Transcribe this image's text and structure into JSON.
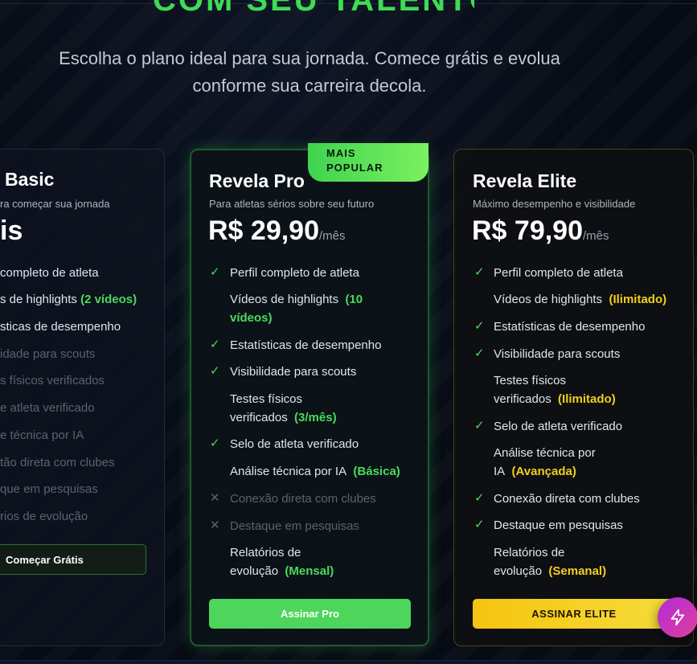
{
  "hero": {
    "heading_fragment": "COM SEU TALENTO",
    "subtitle_line1": "Escolha o plano ideal para sua jornada. Comece grátis e evolua",
    "subtitle_line2": "conforme sua carreira decola."
  },
  "plans": {
    "basic": {
      "name": "Basic",
      "name_visible": "Basic",
      "desc": "ra começar sua jornada",
      "price": "is",
      "features": [
        "completo de atleta",
        "s de highlights",
        "(2 vídeos)",
        "sticas de desempenho",
        "idade para scouts",
        "s físicos verificados",
        "e atleta verificado",
        "e técnica por IA",
        "tão direta com clubes",
        "que em pesquisas",
        "rios de evolução"
      ],
      "button": "Começar Grátis"
    },
    "pro": {
      "badge_line1": "MAIS",
      "badge_line2": "POPULAR",
      "name": "Revela Pro",
      "desc": "Para atletas sérios sobre seu futuro",
      "price": "R$ 29,90",
      "per": "/mês",
      "features": {
        "f1": "Perfil completo de atleta",
        "f2a": "Vídeos de highlights",
        "f2b": "(10",
        "f2c": "vídeos)",
        "f3": "Estatísticas de desempenho",
        "f4": "Visibilidade para scouts",
        "f5a": "Testes físicos",
        "f5b": "verificados",
        "f5c": "(3/mês)",
        "f6": "Selo de atleta verificado",
        "f7a": "Análise técnica por IA",
        "f7b": "(Básica)",
        "f8": "Conexão direta com clubes",
        "f9": "Destaque em pesquisas",
        "f10a": "Relatórios de",
        "f10b": "evolução",
        "f10c": "(Mensal)"
      },
      "button": "Assinar Pro"
    },
    "elite": {
      "name": "Revela Elite",
      "desc": "Máximo desempenho e visibilidade",
      "price": "R$ 79,90",
      "per": "/mês",
      "features": {
        "f1": "Perfil completo de atleta",
        "f2a": "Vídeos de highlights",
        "f2b": "(Ilimitado)",
        "f3": "Estatísticas de desempenho",
        "f4": "Visibilidade para scouts",
        "f5a": "Testes físicos",
        "f5b": "verificados",
        "f5c": "(Ilimitado)",
        "f6": "Selo de atleta verificado",
        "f7a": "Análise técnica por",
        "f7b": "IA",
        "f7c": "(Avançada)",
        "f8": "Conexão direta com clubes",
        "f9": "Destaque em pesquisas",
        "f10a": "Relatórios de",
        "f10b": "evolução",
        "f10c": "(Semanal)"
      },
      "button": "ASSINAR ELITE"
    }
  },
  "colors": {
    "accent_green": "#4cd95c",
    "accent_yellow": "#f2cf1c",
    "background": "#070b14",
    "fab": "#c435c0"
  },
  "icons": {
    "check": "check-icon",
    "cross": "x-icon",
    "fab": "lightning-icon"
  }
}
